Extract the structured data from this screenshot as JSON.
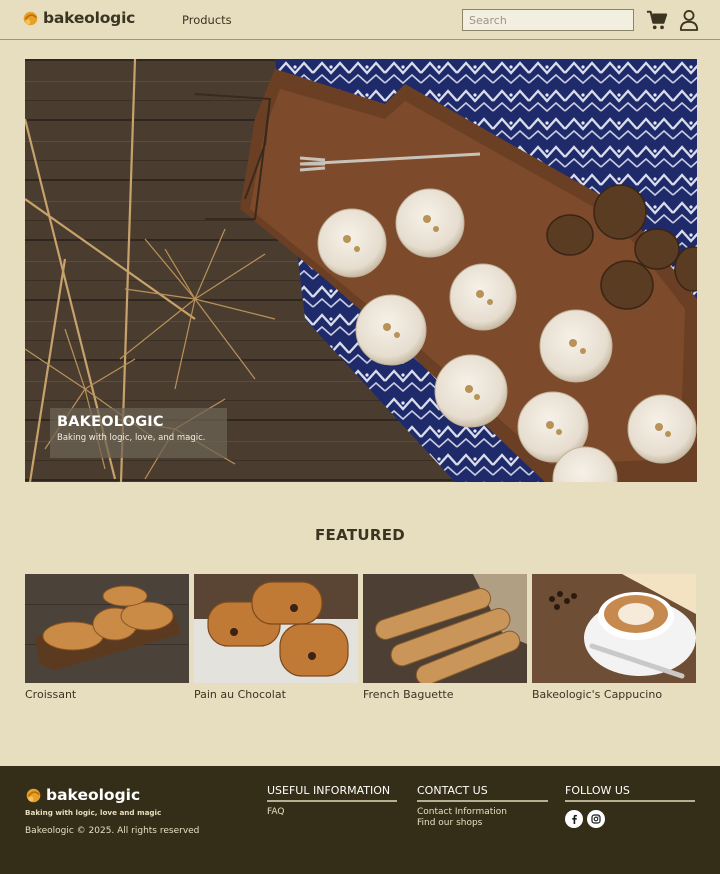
{
  "header": {
    "brand": "bakeologic",
    "nav_products": "Products",
    "search_placeholder": "Search"
  },
  "hero": {
    "title": "BAKEOLOGIC",
    "subtitle": "Baking with logic, love, and magic."
  },
  "featured": {
    "heading": "FEATURED",
    "products": [
      {
        "name": "Croissant"
      },
      {
        "name": "Pain au Chocolat"
      },
      {
        "name": "French Baguette"
      },
      {
        "name": "Bakeologic's Cappucino"
      }
    ]
  },
  "footer": {
    "brand": "bakeologic",
    "tagline": "Baking with logic, love and magic",
    "copyright": "Bakeologic © 2025. All rights reserved",
    "useful": {
      "title": "USEFUL INFORMATION",
      "links": [
        "FAQ"
      ]
    },
    "contact": {
      "title": "CONTACT US",
      "links": [
        "Contact Information",
        "Find our shops"
      ]
    },
    "follow": {
      "title": "FOLLOW US",
      "icons": [
        "facebook-icon",
        "instagram-icon"
      ]
    }
  },
  "colors": {
    "background": "#e7dec0",
    "text": "#3a3421",
    "footer_bg": "#342e18",
    "accent": "#e8a024"
  }
}
